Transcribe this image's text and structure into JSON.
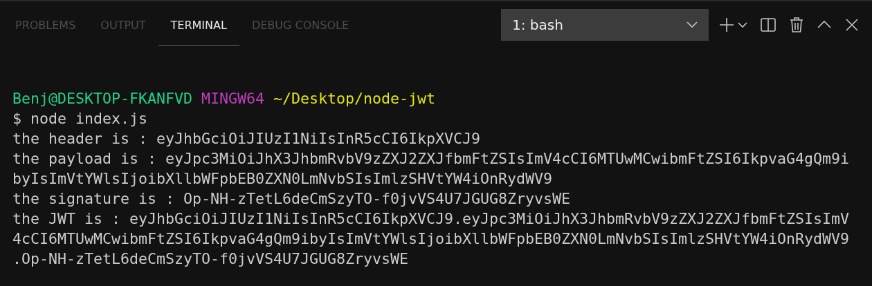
{
  "tabs": [
    {
      "label": "PROBLEMS",
      "selected": false
    },
    {
      "label": "OUTPUT",
      "selected": false
    },
    {
      "label": "TERMINAL",
      "selected": true
    },
    {
      "label": "DEBUG CONSOLE",
      "selected": false
    }
  ],
  "terminal_select": {
    "value": "1: bash"
  },
  "terminal_lines": [
    {
      "kind": "prompt",
      "segments": [
        {
          "text": "Benj@DESKTOP-FKANFVD",
          "color": "#23d18b"
        },
        {
          "text": "MINGW64",
          "color": "#bc3fbc"
        },
        {
          "text": "~/Desktop/node-jwt",
          "color": "#e5e510"
        }
      ]
    },
    {
      "kind": "output",
      "text": "$ node index.js"
    },
    {
      "kind": "output",
      "text": "the header is : eyJhbGciOiJIUzI1NiIsInR5cCI6IkpXVCJ9"
    },
    {
      "kind": "output",
      "text": "the payload is : eyJpc3MiOiJhX3JhbmRvbV9zZXJ2ZXJfbmFtZSIsImV4cCI6MTUwMCwibmFtZSI6IkpvaG4gQm9i"
    },
    {
      "kind": "output",
      "text": "byIsImVtYWlsIjoibXllbWFpbEB0ZXN0LmNvbSIsImlzSHVtYW4iOnRydWV9"
    },
    {
      "kind": "output",
      "text": "the signature is : Op-NH-zTetL6deCmSzyTO-f0jvVS4U7JGUG8ZryvsWE"
    },
    {
      "kind": "output",
      "text": "the JWT is : eyJhbGciOiJIUzI1NiIsInR5cCI6IkpXVCJ9.eyJpc3MiOiJhX3JhbmRvbV9zZXJ2ZXJfbmFtZSIsImV"
    },
    {
      "kind": "output",
      "text": "4cCI6MTUwMCwibmFtZSI6IkpvaG4gQm9ibyIsImVtYWlsIjoibXllbWFpbEB0ZXN0LmNvbSIsImlzSHVtYW4iOnRydWV9"
    },
    {
      "kind": "output",
      "text": ".Op-NH-zTetL6deCmSzyTO-f0jvVS4U7JGUG8ZryvsWE"
    }
  ]
}
